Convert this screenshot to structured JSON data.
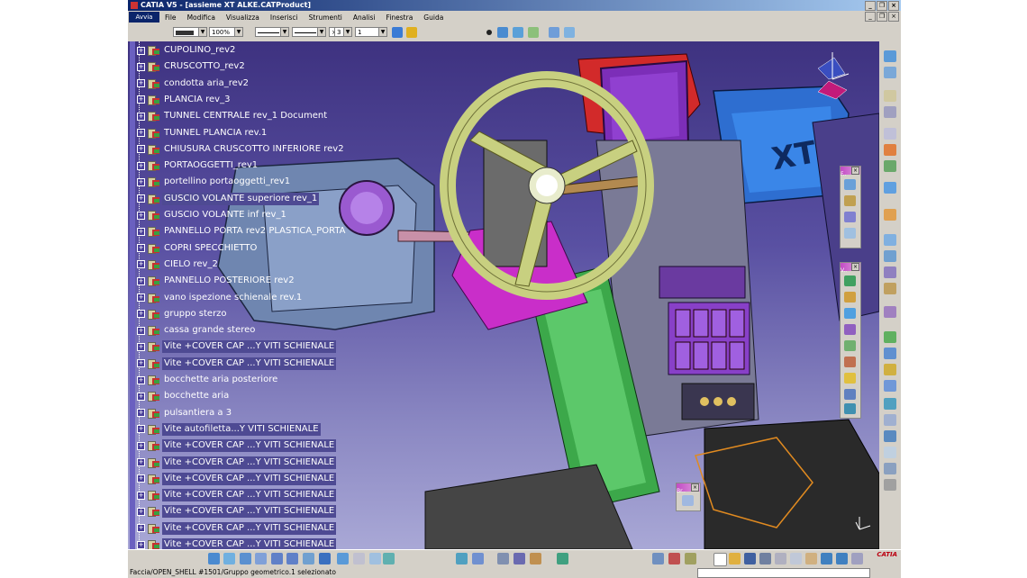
{
  "window": {
    "title": "CATIA V5 - [assieme XT ALKE.CATProduct]",
    "min": "_",
    "restore": "❐",
    "close": "×"
  },
  "menu": {
    "logo": "Avvia",
    "items": [
      "File",
      "Modifica",
      "Visualizza",
      "Inserisci",
      "Strumenti",
      "Analisi",
      "Finestra",
      "Guida"
    ]
  },
  "toolbar": {
    "zoom_value": "100%",
    "layer_value": "3",
    "thickness_value": "1"
  },
  "tree": {
    "nodes": [
      {
        "label": "CUPOLINO_rev2",
        "selected": false
      },
      {
        "label": "CRUSCOTTO_rev2",
        "selected": false
      },
      {
        "label": "condotta aria_rev2",
        "selected": false
      },
      {
        "label": "PLANCIA rev_3",
        "selected": false
      },
      {
        "label": "TUNNEL CENTRALE rev_1 Document",
        "selected": false
      },
      {
        "label": "TUNNEL PLANCIA rev.1",
        "selected": false
      },
      {
        "label": "CHIUSURA CRUSCOTTO INFERIORE rev2",
        "selected": false
      },
      {
        "label": "PORTAOGGETTI_rev1",
        "selected": false
      },
      {
        "label": "portellino portaoggetti_rev1",
        "selected": false
      },
      {
        "label": "GUSCIO VOLANTE superiore rev_1",
        "selected": true
      },
      {
        "label": "GUSCIO VOLANTE inf rev_1",
        "selected": false
      },
      {
        "label": "PANNELLO PORTA rev2 PLASTICA_PORTA",
        "selected": false
      },
      {
        "label": "COPRI SPECCHIETTO",
        "selected": false
      },
      {
        "label": "CIELO rev_2",
        "selected": false
      },
      {
        "label": "PANNELLO POSTERIORE rev2",
        "selected": false
      },
      {
        "label": "vano ispezione schienale rev.1",
        "selected": false
      },
      {
        "label": "gruppo sterzo",
        "selected": false
      },
      {
        "label": "cassa grande stereo",
        "selected": false
      },
      {
        "label": "Vite +COVER CAP ...Y VITI SCHIENALE",
        "selected": true
      },
      {
        "label": "Vite +COVER CAP ...Y VITI SCHIENALE",
        "selected": true
      },
      {
        "label": "bocchette aria posteriore",
        "selected": false
      },
      {
        "label": "bocchette aria",
        "selected": false
      },
      {
        "label": "pulsantiera a 3",
        "selected": false
      },
      {
        "label": "Vite autofiletta...Y VITI SCHIENALE",
        "selected": true
      },
      {
        "label": "Vite +COVER CAP ...Y VITI SCHIENALE",
        "selected": true
      },
      {
        "label": "Vite +COVER CAP ...Y VITI SCHIENALE",
        "selected": true
      },
      {
        "label": "Vite +COVER CAP ...Y VITI SCHIENALE",
        "selected": true
      },
      {
        "label": "Vite +COVER CAP ...Y VITI SCHIENALE",
        "selected": true
      },
      {
        "label": "Vite +COVER CAP ...Y VITI SCHIENALE",
        "selected": true
      },
      {
        "label": "Vite +COVER CAP ...Y VITI SCHIENALE",
        "selected": true
      },
      {
        "label": "Vite +COVER CAP ...Y VITI SCHIENALE",
        "selected": true
      }
    ]
  },
  "scene": {
    "xt_label": "XT"
  },
  "palettes": {
    "p1": "F..",
    "p2": "V..",
    "p3": "Br.."
  },
  "status": {
    "text": "Faccia/OPEN_SHELL #1501/Gruppo geometrico.1 selezionato"
  },
  "brand": "CATIA",
  "colors": {
    "title_active": "#0a246a",
    "viewport_top": "#3e3280",
    "viewport_bottom": "#a9a8d6",
    "selection": "#4e4a93"
  }
}
